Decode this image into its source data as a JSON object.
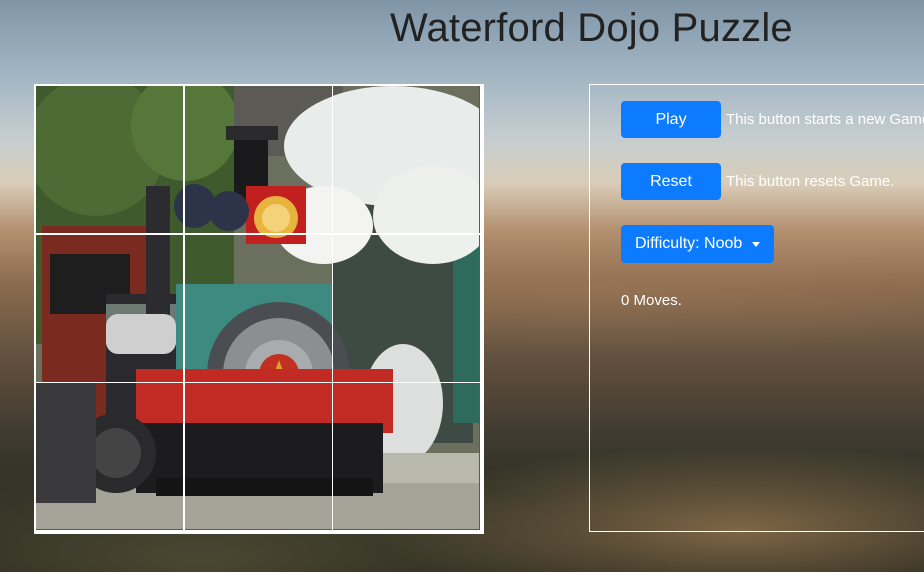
{
  "title": "Waterford Dojo Puzzle",
  "board": {
    "image": "steam-locomotive-photo",
    "rows": 3,
    "cols": 3,
    "tiles": [
      0,
      1,
      2,
      3,
      4,
      5,
      6,
      7,
      8
    ]
  },
  "controls": {
    "play_label": "Play",
    "play_desc": "This button starts a new Game.",
    "reset_label": "Reset",
    "reset_desc": "This button resets Game.",
    "difficulty_label": "Difficulty: Noob",
    "moves_text": "0 Moves."
  },
  "colors": {
    "accent": "#0d7bff",
    "title": "#222222",
    "text": "#ffffff"
  }
}
